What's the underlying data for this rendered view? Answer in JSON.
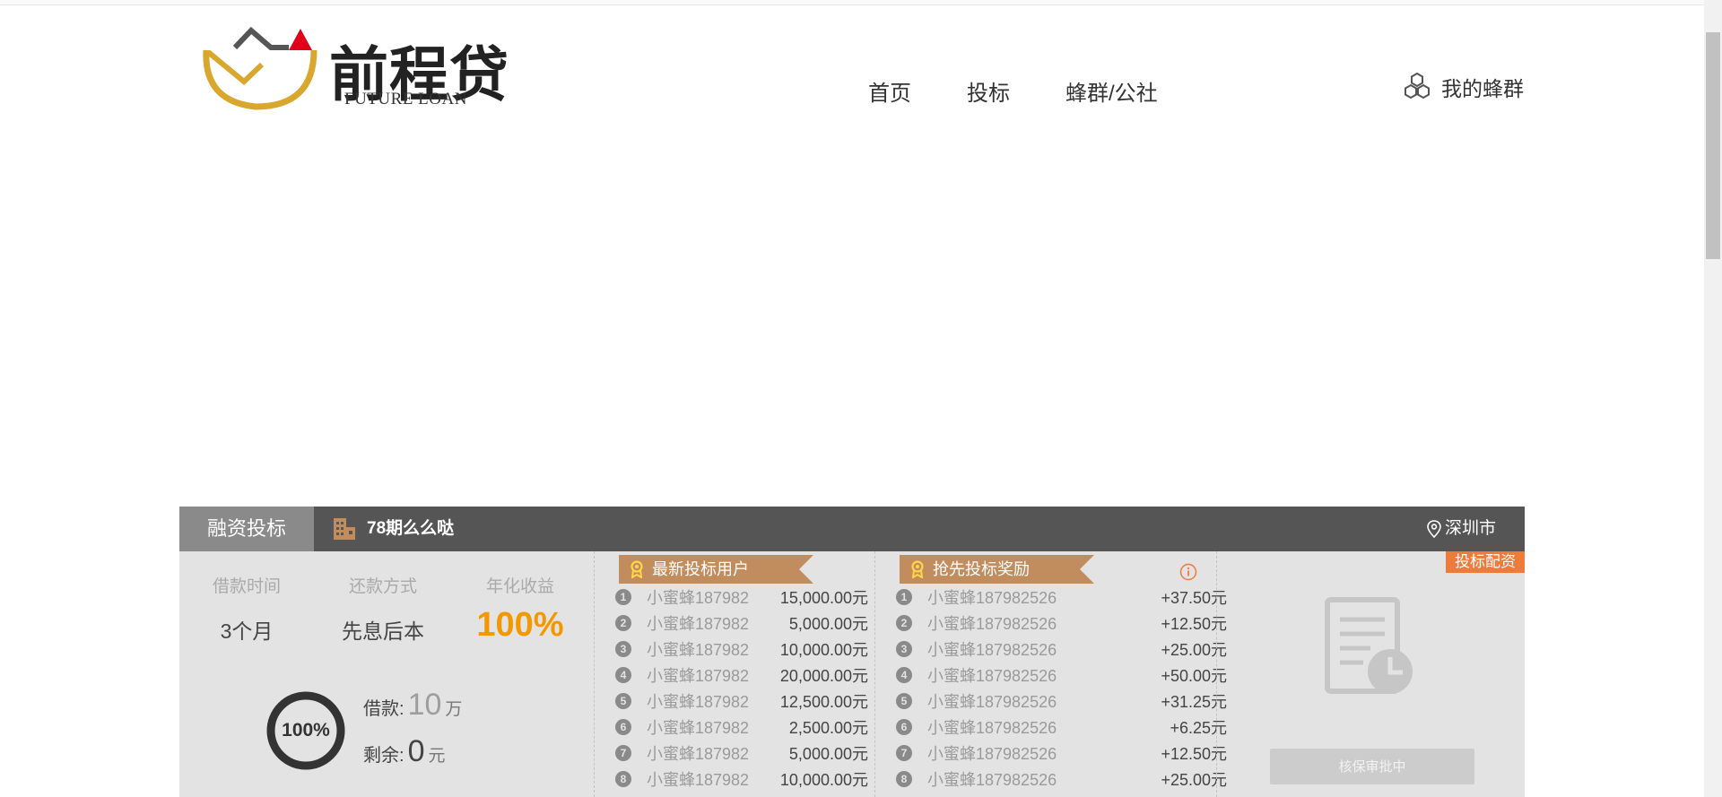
{
  "header": {
    "logo_cn": "前程贷",
    "logo_en": "FUTURE LOAN",
    "nav": [
      "首页",
      "投标",
      "蜂群/公社"
    ],
    "user_label": "我的蜂群"
  },
  "card": {
    "tab_label": "融资投标",
    "project_name": "78期么么哒",
    "city": "深圳市",
    "summary": {
      "term_label": "借款时间",
      "term_value": "3个月",
      "repay_label": "还款方式",
      "repay_value": "先息后本",
      "rate_label": "年化收益",
      "rate_value": "100%"
    },
    "progress": {
      "percent_text": "100%",
      "percent": 1.0,
      "loan_label": "借款:",
      "loan_value": "10",
      "loan_unit": "万",
      "remain_label": "剩余:",
      "remain_value": "0",
      "remain_unit": "元"
    },
    "latest_investors": {
      "title": "最新投标用户",
      "rows": [
        {
          "rank": "1",
          "name": "小蜜蜂187982",
          "amount": "15,000.00元"
        },
        {
          "rank": "2",
          "name": "小蜜蜂187982",
          "amount": "5,000.00元"
        },
        {
          "rank": "3",
          "name": "小蜜蜂187982",
          "amount": "10,000.00元"
        },
        {
          "rank": "4",
          "name": "小蜜蜂187982",
          "amount": "20,000.00元"
        },
        {
          "rank": "5",
          "name": "小蜜蜂187982",
          "amount": "12,500.00元"
        },
        {
          "rank": "6",
          "name": "小蜜蜂187982",
          "amount": "2,500.00元"
        },
        {
          "rank": "7",
          "name": "小蜜蜂187982",
          "amount": "5,000.00元"
        },
        {
          "rank": "8",
          "name": "小蜜蜂187982",
          "amount": "10,000.00元"
        }
      ]
    },
    "early_rewards": {
      "title": "抢先投标奖励",
      "rows": [
        {
          "rank": "1",
          "name": "小蜜蜂187982526",
          "amount": "+37.50元"
        },
        {
          "rank": "2",
          "name": "小蜜蜂187982526",
          "amount": "+12.50元"
        },
        {
          "rank": "3",
          "name": "小蜜蜂187982526",
          "amount": "+25.00元"
        },
        {
          "rank": "4",
          "name": "小蜜蜂187982526",
          "amount": "+50.00元"
        },
        {
          "rank": "5",
          "name": "小蜜蜂187982526",
          "amount": "+31.25元"
        },
        {
          "rank": "6",
          "name": "小蜜蜂187982526",
          "amount": "+6.25元"
        },
        {
          "rank": "7",
          "name": "小蜜蜂187982526",
          "amount": "+12.50元"
        },
        {
          "rank": "8",
          "name": "小蜜蜂187982526",
          "amount": "+25.00元"
        }
      ]
    },
    "right": {
      "tag": "投标配资",
      "button": "核保审批中"
    }
  },
  "colors": {
    "accent_orange": "#f39800",
    "ribbon": "#c18d5e",
    "tag": "#ee7a3b",
    "header_bar": "#555555",
    "logo_gold": "#d9a62e",
    "logo_red": "#e0001b"
  },
  "icons": [
    "logo-mark",
    "hexagons-icon",
    "building-icon",
    "location-pin-icon",
    "medal-icon",
    "info-icon",
    "document-clock-icon"
  ]
}
